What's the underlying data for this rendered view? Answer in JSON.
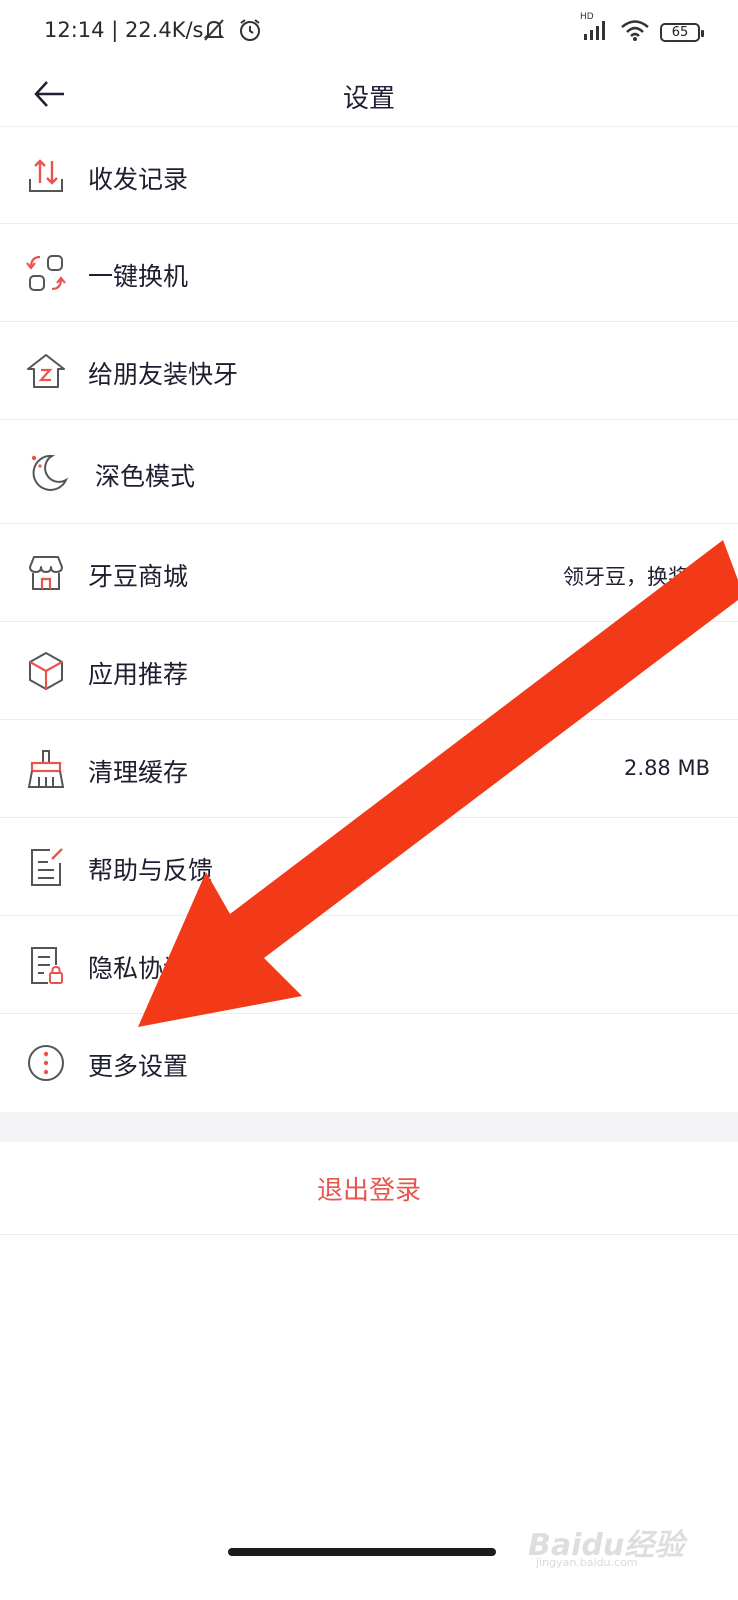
{
  "status": {
    "time": "12:14 | 22.4K/s",
    "network_label": "HD",
    "battery": "65"
  },
  "header": {
    "title": "设置"
  },
  "items": [
    {
      "label": "收发记录",
      "value": "",
      "icon": "transfer-record-icon"
    },
    {
      "label": "一键换机",
      "value": "",
      "icon": "phone-switch-icon"
    },
    {
      "label": "给朋友装快牙",
      "value": "",
      "icon": "install-for-friend-icon"
    },
    {
      "label": "深色模式",
      "value": "",
      "icon": "moon-icon"
    },
    {
      "label": "牙豆商城",
      "value": "领牙豆，换奖品",
      "icon": "store-icon"
    },
    {
      "label": "应用推荐",
      "value": "",
      "icon": "cube-icon"
    },
    {
      "label": "清理缓存",
      "value": "2.88 MB",
      "icon": "broom-icon"
    },
    {
      "label": "帮助与反馈",
      "value": "",
      "icon": "feedback-doc-icon"
    },
    {
      "label": "隐私协议",
      "value": "",
      "icon": "privacy-lock-doc-icon"
    },
    {
      "label": "更多设置",
      "value": "",
      "icon": "more-dots-icon"
    }
  ],
  "logout": {
    "label": "退出登录"
  },
  "watermark": {
    "brand": "Baidu经验",
    "url": "jingyan.baidu.com"
  },
  "colors": {
    "accent_red": "#e8554e",
    "arrow_red": "#f23a18",
    "text_dark": "#1d1e2f",
    "divider": "#ededed",
    "band": "#f4f4f6"
  }
}
